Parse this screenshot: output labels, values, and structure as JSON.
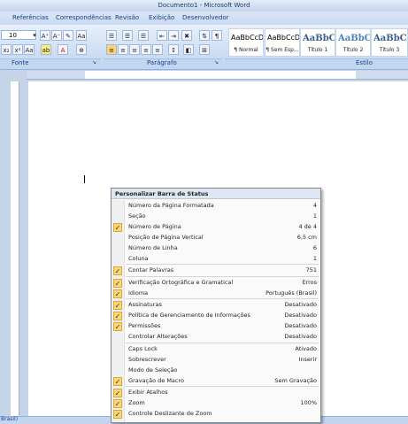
{
  "window": {
    "title": "Documento1 - Microsoft Word"
  },
  "tabs": [
    "Referências",
    "Correspondências",
    "Revisão",
    "Exibição",
    "Desenvolvedor"
  ],
  "ribbon": {
    "font_size": "10",
    "groups": {
      "font": "Fonte",
      "paragraph": "Parágrafo",
      "styles": "Estilo"
    },
    "styles": [
      {
        "sample": "AaBbCcDc",
        "name": "¶ Normal",
        "heading": false
      },
      {
        "sample": "AaBbCcDc",
        "name": "¶ Sem Esp...",
        "heading": false
      },
      {
        "sample": "AaBbC(",
        "name": "Título 1",
        "heading": true
      },
      {
        "sample": "AaBbCc",
        "name": "Título 2",
        "heading": true
      },
      {
        "sample": "AaBbC",
        "name": "Título 3",
        "heading": true
      }
    ]
  },
  "statusbar": {
    "language": "Brasil)"
  },
  "menu": {
    "title": "Personalizar Barra de Status",
    "items": [
      {
        "label": "Número da Página Formatada",
        "value": "4",
        "checked": false
      },
      {
        "label": "Seção",
        "value": "1",
        "checked": false
      },
      {
        "label": "Número de Página",
        "value": "4 de 4",
        "checked": true
      },
      {
        "label": "Posição de Página Vertical",
        "value": "6,5 cm",
        "checked": false
      },
      {
        "label": "Número de Linha",
        "value": "6",
        "checked": false
      },
      {
        "label": "Coluna",
        "value": "1",
        "checked": false
      },
      {
        "label": "Contar Palavras",
        "value": "751",
        "checked": true
      },
      {
        "label": "Verificação Ortográfica e Gramatical",
        "value": "Erros",
        "checked": true
      },
      {
        "label": "Idioma",
        "value": "Português (Brasil)",
        "checked": true
      },
      {
        "label": "Assinaturas",
        "value": "Desativado",
        "checked": true
      },
      {
        "label": "Política de Gerenciamento de Informações",
        "value": "Desativado",
        "checked": true
      },
      {
        "label": "Permissões",
        "value": "Desativado",
        "checked": true
      },
      {
        "label": "Controlar Alterações",
        "value": "Desativado",
        "checked": false
      },
      {
        "label": "Caps Lock",
        "value": "Ativado",
        "checked": false
      },
      {
        "label": "Sobrescrever",
        "value": "Inserir",
        "checked": false
      },
      {
        "label": "Modo de Seleção",
        "value": "",
        "checked": false
      },
      {
        "label": "Gravação de Macro",
        "value": "Sem Gravação",
        "checked": true
      },
      {
        "label": "Exibir Atalhos",
        "value": "",
        "checked": true
      },
      {
        "label": "Zoom",
        "value": "100%",
        "checked": true
      },
      {
        "label": "Controle Deslizante de Zoom",
        "value": "",
        "checked": true
      }
    ]
  }
}
